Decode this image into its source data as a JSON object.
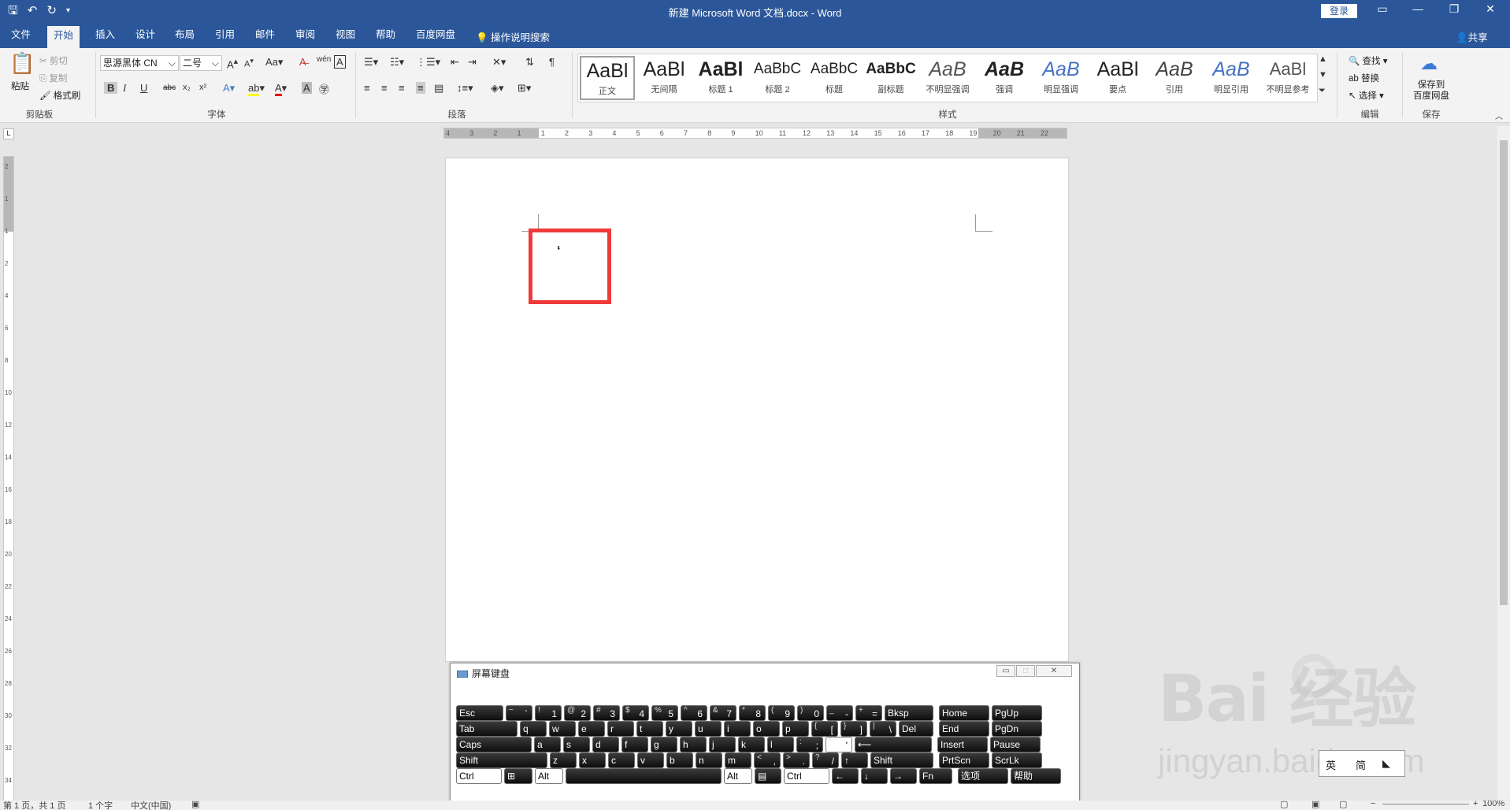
{
  "window": {
    "title": "新建 Microsoft Word 文档.docx - Word",
    "login_label": "登录"
  },
  "qat": {
    "save_icon": "save-icon",
    "undo_icon": "undo-icon",
    "redo_icon": "redo-icon"
  },
  "tabs": [
    "文件",
    "开始",
    "插入",
    "设计",
    "布局",
    "引用",
    "邮件",
    "审阅",
    "视图",
    "帮助",
    "百度网盘"
  ],
  "active_tab": "开始",
  "tell_me": "操作说明搜索",
  "share_label": "共享",
  "ribbon": {
    "clipboard": {
      "paste": "粘贴",
      "cut": "剪切",
      "copy": "复制",
      "format_painter": "格式刷",
      "label": "剪贴板"
    },
    "font": {
      "font_name": "思源黑体 CN",
      "font_size": "二号",
      "label": "字体",
      "case_label": "Aa",
      "bold": "B",
      "italic": "I",
      "underline": "U",
      "strike": "abc",
      "sub": "x₂",
      "sup": "x²"
    },
    "paragraph": {
      "label": "段落"
    },
    "styles": {
      "label": "样式",
      "items": [
        {
          "sample": "AaBl",
          "name": "正文"
        },
        {
          "sample": "AaBl",
          "name": "无间隔"
        },
        {
          "sample": "AaBl",
          "name": "标题 1"
        },
        {
          "sample": "AaBbC",
          "name": "标题 2"
        },
        {
          "sample": "AaBbC",
          "name": "标题"
        },
        {
          "sample": "AaBbC",
          "name": "副标题"
        },
        {
          "sample": "AaB",
          "name": "不明显强调"
        },
        {
          "sample": "AaB",
          "name": "强调"
        },
        {
          "sample": "AaB",
          "name": "明显强调"
        },
        {
          "sample": "AaBl",
          "name": "要点"
        },
        {
          "sample": "AaB",
          "name": "引用"
        },
        {
          "sample": "AaB",
          "name": "明显引用"
        },
        {
          "sample": "AaBl",
          "name": "不明显参考"
        }
      ]
    },
    "editing": {
      "find": "查找",
      "replace": "替换",
      "select": "选择",
      "label": "编辑"
    },
    "save": {
      "save_to_baidu_line1": "保存到",
      "save_to_baidu_line2": "百度网盘",
      "label": "保存"
    }
  },
  "ruler": {
    "h_ticks": [
      "4",
      "3",
      "2",
      "1",
      "1",
      "2",
      "3",
      "4",
      "5",
      "6",
      "7",
      "8",
      "9",
      "10",
      "11",
      "12",
      "13",
      "14",
      "15",
      "16",
      "17",
      "18",
      "19",
      "20",
      "21",
      "22"
    ],
    "v_ticks": [
      "2",
      "1",
      "1",
      "2",
      "4",
      "6",
      "8",
      "10",
      "12",
      "14",
      "16",
      "18",
      "20",
      "22",
      "24",
      "26",
      "28",
      "30",
      "32",
      "34"
    ]
  },
  "document": {
    "typed_char": "‘"
  },
  "osk": {
    "title": "屏幕键盘",
    "rows": [
      [
        {
          "main": "Esc",
          "w": 62
        },
        {
          "sub": "~",
          "main": "`",
          "w": 36
        },
        {
          "sub": "!",
          "main": "1",
          "w": 36
        },
        {
          "sub": "@",
          "main": "2",
          "w": 36
        },
        {
          "sub": "#",
          "main": "3",
          "w": 36
        },
        {
          "sub": "$",
          "main": "4",
          "w": 36
        },
        {
          "sub": "%",
          "main": "5",
          "w": 36
        },
        {
          "sub": "^",
          "main": "6",
          "w": 36
        },
        {
          "sub": "&",
          "main": "7",
          "w": 36
        },
        {
          "sub": "*",
          "main": "8",
          "w": 36
        },
        {
          "sub": "(",
          "main": "9",
          "w": 36
        },
        {
          "sub": ")",
          "main": "0",
          "w": 36
        },
        {
          "sub": "_",
          "main": "-",
          "w": 36
        },
        {
          "sub": "+",
          "main": "=",
          "w": 36
        },
        {
          "main": "Bksp",
          "w": 64
        },
        {
          "main": "Home",
          "w": 66,
          "gap": 4
        },
        {
          "main": "PgUp",
          "w": 66
        }
      ],
      [
        {
          "main": "Tab",
          "w": 80
        },
        {
          "main": "q",
          "w": 36
        },
        {
          "main": "w",
          "w": 36
        },
        {
          "main": "e",
          "w": 36
        },
        {
          "main": "r",
          "w": 36
        },
        {
          "main": "t",
          "w": 36
        },
        {
          "main": "y",
          "w": 36
        },
        {
          "main": "u",
          "w": 36
        },
        {
          "main": "i",
          "w": 36
        },
        {
          "main": "o",
          "w": 36
        },
        {
          "main": "p",
          "w": 36
        },
        {
          "sub": "{",
          "main": "[",
          "w": 36
        },
        {
          "sub": "}",
          "main": "]",
          "w": 36
        },
        {
          "sub": "|",
          "main": "\\",
          "w": 36
        },
        {
          "main": "Del",
          "w": 46
        },
        {
          "main": "End",
          "w": 66,
          "gap": 4
        },
        {
          "main": "PgDn",
          "w": 66
        }
      ],
      [
        {
          "main": "Caps",
          "w": 98
        },
        {
          "main": "a",
          "w": 36
        },
        {
          "main": "s",
          "w": 36
        },
        {
          "main": "d",
          "w": 36
        },
        {
          "main": "f",
          "w": 36
        },
        {
          "main": "g",
          "w": 36
        },
        {
          "main": "h",
          "w": 36
        },
        {
          "main": "j",
          "w": 36
        },
        {
          "main": "k",
          "w": 36
        },
        {
          "main": "l",
          "w": 36
        },
        {
          "sub": ":",
          "main": ";",
          "w": 36
        },
        {
          "sub": "\"",
          "main": "'",
          "w": 36,
          "white": true
        },
        {
          "main": "⟵",
          "w": 100
        },
        {
          "main": "Insert",
          "w": 66,
          "gap": 4
        },
        {
          "main": "Pause",
          "w": 66
        }
      ],
      [
        {
          "main": "Shift",
          "w": 118
        },
        {
          "main": "z",
          "w": 36
        },
        {
          "main": "x",
          "w": 36
        },
        {
          "main": "c",
          "w": 36
        },
        {
          "main": "v",
          "w": 36
        },
        {
          "main": "b",
          "w": 36
        },
        {
          "main": "n",
          "w": 36
        },
        {
          "main": "m",
          "w": 36
        },
        {
          "sub": "<",
          "main": ",",
          "w": 36
        },
        {
          "sub": ">",
          "main": ".",
          "w": 36
        },
        {
          "sub": "?",
          "main": "/",
          "w": 36
        },
        {
          "main": "↑",
          "w": 36
        },
        {
          "main": "Shift",
          "w": 82
        },
        {
          "main": "PrtScn",
          "w": 66,
          "gap": 4
        },
        {
          "main": "ScrLk",
          "w": 66
        }
      ],
      [
        {
          "main": "Ctrl",
          "w": 60,
          "white": true
        },
        {
          "main": "⊞",
          "w": 38
        },
        {
          "main": "Alt",
          "w": 38,
          "white": true
        },
        {
          "main": "",
          "w": 200
        },
        {
          "main": "Alt",
          "w": 38,
          "white": true
        },
        {
          "main": "▤",
          "w": 36
        },
        {
          "main": "Ctrl",
          "w": 60,
          "white": true
        },
        {
          "main": "←",
          "w": 36
        },
        {
          "main": "↓",
          "w": 36
        },
        {
          "main": "→",
          "w": 36
        },
        {
          "main": "Fn",
          "w": 44
        },
        {
          "main": "选项",
          "w": 66,
          "gap": 4
        },
        {
          "main": "帮助",
          "w": 66
        }
      ]
    ]
  },
  "statusbar": {
    "page": "第 1 页，共 1 页",
    "words": "1 个字",
    "lang": "中文(中国)",
    "zoom": "100%"
  },
  "watermark": {
    "logo": "Bai 经验",
    "url": "jingyan.baidu.com"
  },
  "ime": {
    "lang": "英",
    "mode": "简"
  }
}
